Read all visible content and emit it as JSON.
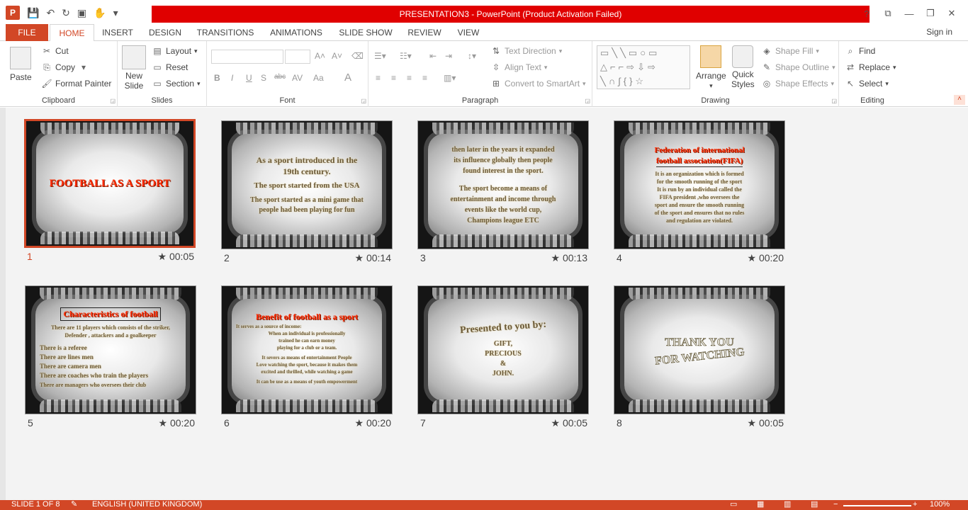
{
  "app": {
    "logo": "P",
    "title": "PRESENTATION3 -  PowerPoint (Product Activation Failed)",
    "window_buttons": [
      "?",
      "⧉",
      "—",
      "❐",
      "✕"
    ],
    "signin": "Sign in"
  },
  "tabs": [
    "FILE",
    "HOME",
    "INSERT",
    "DESIGN",
    "TRANSITIONS",
    "ANIMATIONS",
    "SLIDE SHOW",
    "REVIEW",
    "VIEW"
  ],
  "ribbon": {
    "clipboard": {
      "label": "Clipboard",
      "paste": "Paste",
      "cut": "Cut",
      "copy": "Copy",
      "format_painter": "Format Painter"
    },
    "slides": {
      "label": "Slides",
      "new_slide_1": "New",
      "new_slide_2": "Slide",
      "layout": "Layout",
      "reset": "Reset",
      "section": "Section"
    },
    "font": {
      "label": "Font",
      "bold": "B",
      "italic": "I",
      "underline": "U",
      "shadow": "S",
      "strike": "abc",
      "spacing": "AV",
      "case": "Aa",
      "color": "A"
    },
    "paragraph": {
      "label": "Paragraph",
      "text_direction": "Text Direction",
      "align_text": "Align Text",
      "convert": "Convert to SmartArt"
    },
    "drawing": {
      "label": "Drawing",
      "arrange": "Arrange",
      "quick_1": "Quick",
      "quick_2": "Styles",
      "shape_fill": "Shape Fill",
      "shape_outline": "Shape Outline",
      "shape_effects": "Shape Effects"
    },
    "editing": {
      "label": "Editing",
      "find": "Find",
      "replace": "Replace",
      "select": "Select"
    }
  },
  "slides": [
    {
      "num": "1",
      "time": "00:05",
      "lines": [
        "FOOTBALL AS A SPORT"
      ]
    },
    {
      "num": "2",
      "time": "00:14",
      "lines": [
        "As a sport introduced in the",
        "19th century.",
        "The sport started from  the USA",
        "The sport started as a mini game that",
        "people had been playing for fun"
      ]
    },
    {
      "num": "3",
      "time": "00:13",
      "lines": [
        "then later in the years it expanded",
        "its influence globally then people",
        "found interest in the sport.",
        "The sport become a means of",
        "entertainment and income through",
        "events like the world cup,",
        "Champions league ETC"
      ]
    },
    {
      "num": "4",
      "time": "00:20",
      "lines": [
        "Federation of  international",
        "football association(FIFA)",
        "It is an organization which is formed",
        "for the smooth running of the sport",
        "It is run by an individual called the",
        "FIFA president ,who oversees the",
        "sport and ensure the  smooth running",
        "of the sport and ensures that no rules",
        "and regulation are violated."
      ]
    },
    {
      "num": "5",
      "time": "00:20",
      "lines": [
        "Characteristics of football",
        "There are 11 players which consists of the striker,",
        "Defender , attackers and a goalkeeper",
        "There is a referee",
        "There are lines men",
        "There are camera men",
        "There are coaches who train the players",
        "There are managers who oversees their club"
      ]
    },
    {
      "num": "6",
      "time": "00:20",
      "lines": [
        "Benefit of  football as a sport",
        "It serves as a source of income:",
        "When an individual is professionally",
        "trained  he can earn money",
        "playing for a club or a team.",
        "It severs as means of entertainment People",
        "Love watching the sport, because it makes them",
        "excited and thrilled, while watching a game",
        "It can be use as a means of  youth empowerment"
      ]
    },
    {
      "num": "7",
      "time": "00:05",
      "lines": [
        "Presented to you by:",
        "GIFT,",
        "PRECIOUS",
        "&",
        "JOHN."
      ]
    },
    {
      "num": "8",
      "time": "00:05",
      "lines": [
        "THANK YOU",
        "FOR WATCHING"
      ]
    }
  ],
  "status": {
    "slide_info": "SLIDE 1 OF 8",
    "language": "ENGLISH (UNITED KINGDOM)",
    "zoom": "100%"
  }
}
